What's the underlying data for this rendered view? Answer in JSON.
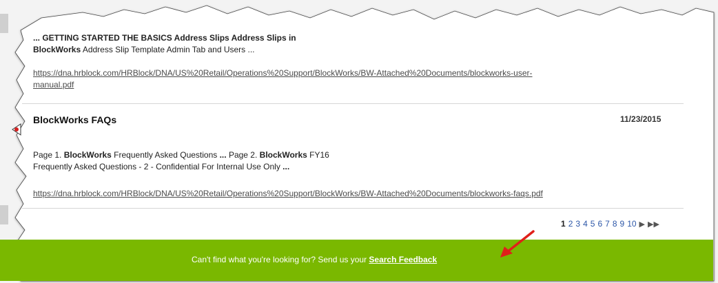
{
  "result_1": {
    "snippet_line1_prefix": "... GETTING STARTED  THE BASICS Address Slips Address Slips in",
    "snippet_line2_bold": "BlockWorks",
    "snippet_line2_rest": " Address Slip Template Admin Tab and Users ...",
    "url_line1": "https://dna.hrblock.com/HRBlock/DNA/US%20Retail/Operations%20Support/BlockWorks/BW-Attached%20Documents/blockworks-user-",
    "url_line2": "manual.pdf"
  },
  "result_2": {
    "title": "BlockWorks FAQs",
    "date": "11/23/2015",
    "snippet_a": "Page 1. ",
    "snippet_b": "BlockWorks",
    "snippet_c": " Frequently Asked Questions ",
    "snippet_d": "...",
    "snippet_e": " Page 2. ",
    "snippet_f": "BlockWorks",
    "snippet_g": " FY16",
    "snippet_line2": "Frequently Asked Questions - 2 - Confidential  For Internal Use Only ",
    "snippet_line2_end": "...",
    "url": "https://dna.hrblock.com/HRBlock/DNA/US%20Retail/Operations%20Support/BlockWorks/BW-Attached%20Documents/blockworks-faqs.pdf"
  },
  "pagination": {
    "current": "1",
    "pages": [
      "2",
      "3",
      "4",
      "5",
      "6",
      "7",
      "8",
      "9",
      "10"
    ],
    "next_icon": "▶",
    "last_icon": "▶▶"
  },
  "feedback": {
    "text": "Can't find what you're looking for? Send us your ",
    "link": "Search Feedback"
  },
  "colors": {
    "feedback_bar": "#7ab800",
    "link": "#4a4a4a",
    "pager_link": "#2d57a8",
    "annotation_arrow": "#e0201a"
  }
}
